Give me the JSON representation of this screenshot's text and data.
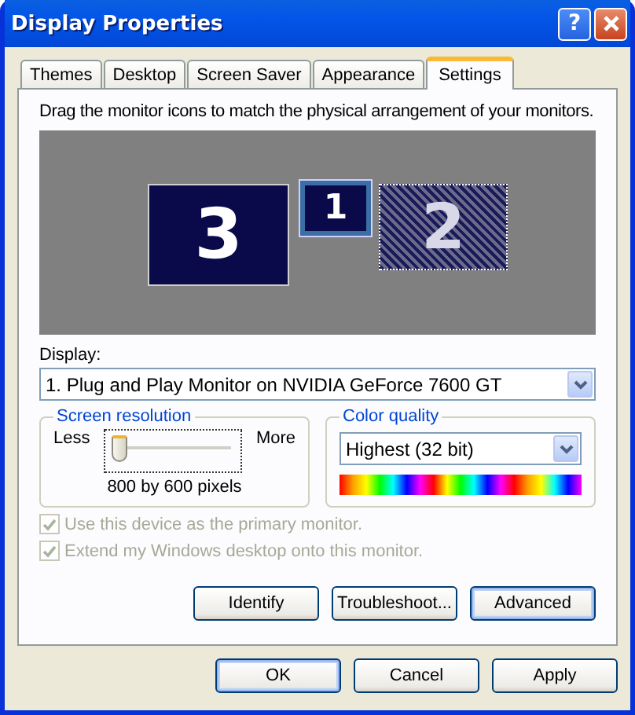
{
  "window": {
    "title": "Display Properties",
    "help_button": "?"
  },
  "tabs": [
    {
      "label": "Themes",
      "selected": false
    },
    {
      "label": "Desktop",
      "selected": false
    },
    {
      "label": "Screen Saver",
      "selected": false
    },
    {
      "label": "Appearance",
      "selected": false
    },
    {
      "label": "Settings",
      "selected": true
    }
  ],
  "instructions": "Drag the monitor icons to match the physical arrangement of your monitors.",
  "monitors": [
    {
      "label": "3",
      "selected": false,
      "attached": true
    },
    {
      "label": "1",
      "selected": true,
      "attached": true
    },
    {
      "label": "2",
      "selected": false,
      "attached": false
    }
  ],
  "display": {
    "label": "Display:",
    "value": "1. Plug and Play Monitor on NVIDIA GeForce 7600 GT"
  },
  "screen_resolution": {
    "title": "Screen resolution",
    "less": "Less",
    "more": "More",
    "level": 0.0,
    "reading": "800 by 600 pixels"
  },
  "color_quality": {
    "title": "Color quality",
    "value": "Highest (32 bit)"
  },
  "options": [
    {
      "label": "Use this device as the primary monitor.",
      "checked": true,
      "disabled": true
    },
    {
      "label": "Extend my Windows desktop onto this monitor.",
      "checked": true,
      "disabled": true
    }
  ],
  "panel_buttons": [
    {
      "label": "Identify",
      "default": false
    },
    {
      "label": "Troubleshoot...",
      "default": false
    },
    {
      "label": "Advanced",
      "default": true
    }
  ],
  "dialog_buttons": [
    {
      "label": "OK",
      "default": true
    },
    {
      "label": "Cancel",
      "default": false
    },
    {
      "label": "Apply",
      "default": false
    }
  ]
}
